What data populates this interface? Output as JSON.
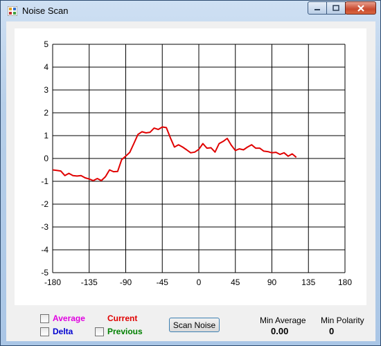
{
  "window": {
    "title": "Noise Scan"
  },
  "controls": {
    "average_label": "Average",
    "delta_label": "Delta",
    "current_label": "Current",
    "previous_label": "Previous",
    "scan_button": "Scan Noise",
    "min_average_label": "Min Average",
    "min_average_value": "0.00",
    "min_polarity_label": "Min Polarity",
    "min_polarity_value": "0"
  },
  "colors": {
    "average": "#e000e0",
    "delta": "#0000d0",
    "current": "#e00000",
    "previous": "#008000",
    "line": "#e00000"
  },
  "chart_data": {
    "type": "line",
    "xlim": [
      -180,
      180
    ],
    "ylim": [
      -5,
      5
    ],
    "xticks": [
      -180,
      -135,
      -90,
      -45,
      0,
      45,
      90,
      135,
      180
    ],
    "yticks": [
      5,
      4,
      3,
      2,
      1,
      0,
      -1,
      -2,
      -3,
      -4,
      -5
    ],
    "grid": true,
    "x": [
      -180,
      -175,
      -170,
      -165,
      -160,
      -155,
      -150,
      -145,
      -140,
      -135,
      -130,
      -125,
      -120,
      -115,
      -110,
      -105,
      -100,
      -95,
      -90,
      -85,
      -80,
      -75,
      -70,
      -65,
      -60,
      -55,
      -50,
      -45,
      -40,
      -35,
      -30,
      -25,
      -20,
      -15,
      -10,
      -5,
      0,
      5,
      10,
      15,
      20,
      25,
      30,
      35,
      40,
      45,
      50,
      55,
      60,
      65,
      70,
      75,
      80,
      85,
      90,
      95,
      100,
      105,
      110,
      115,
      120,
      125,
      130,
      135,
      140,
      145,
      150,
      155,
      160,
      165,
      170,
      175,
      180
    ],
    "series": [
      {
        "values": [
          -0.5,
          -0.52,
          -0.55,
          -0.75,
          -0.65,
          -0.75,
          -0.77,
          -0.75,
          -0.85,
          -0.9,
          -0.97,
          -0.88,
          -0.97,
          -0.8,
          -0.5,
          -0.58,
          -0.57,
          -0.05,
          0.1,
          0.27,
          0.65,
          1.05,
          1.17,
          1.12,
          1.15,
          1.33,
          1.27,
          1.38,
          1.35,
          0.9,
          0.5,
          0.6,
          0.5,
          0.38,
          0.25,
          0.28,
          0.4,
          0.65,
          0.45,
          0.47,
          0.28,
          0.65,
          0.75,
          0.88,
          0.58,
          0.35,
          0.42,
          0.38,
          0.5,
          0.6,
          0.45,
          0.45,
          0.32,
          0.3,
          0.25,
          0.27,
          0.18,
          0.25,
          0.1,
          0.2,
          0.05
        ]
      }
    ]
  }
}
